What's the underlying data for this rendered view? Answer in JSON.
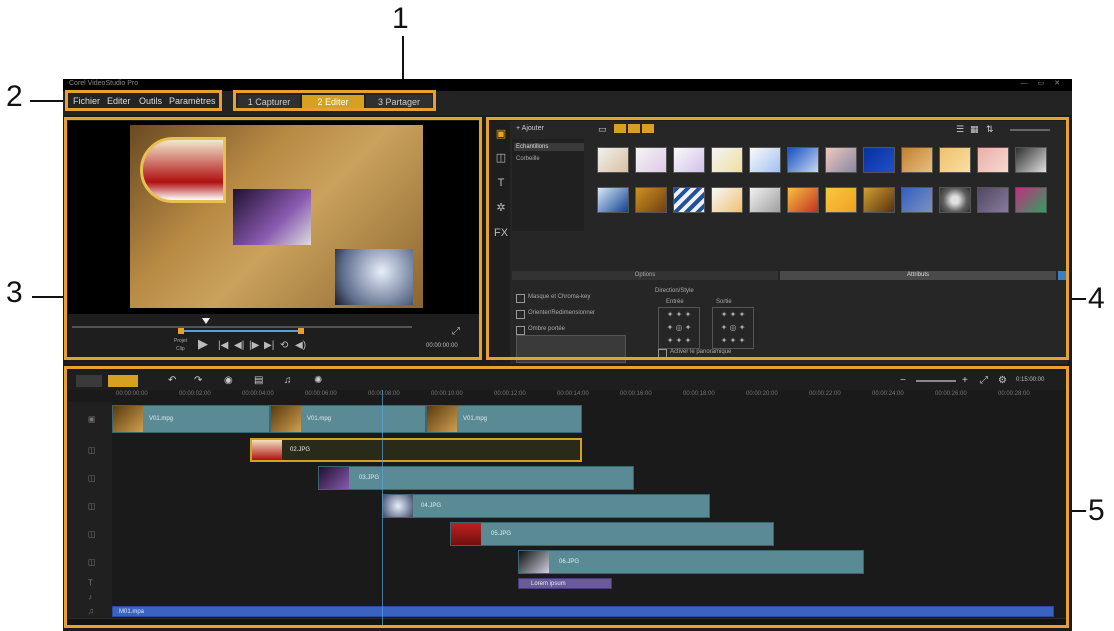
{
  "callouts": {
    "c1": "1",
    "c2": "2",
    "c3": "3",
    "c4": "4",
    "c5": "5"
  },
  "colors": {
    "callout_box": "#e8a030",
    "accent_tab": "#d6a020",
    "clip": "#5a8a94",
    "audio_track": "#3a62c0",
    "title_clip": "#6a5a9a"
  },
  "titlebar": {
    "title": "Corel VideoStudio Pro",
    "window_controls": "— ▭ ✕"
  },
  "menu": {
    "items": [
      "Fichier",
      "Editer",
      "Outils",
      "Paramètres"
    ]
  },
  "steps": {
    "tabs": [
      "1 Capturer",
      "2 Editer",
      "3 Partager"
    ],
    "active": "2 Editer"
  },
  "player": {
    "mode_labels": [
      "Projet",
      "Clip"
    ],
    "timecode": "00:00:00:00",
    "control_icons": [
      "play-icon",
      "home-icon",
      "previous-frame-icon",
      "next-frame-icon",
      "end-icon",
      "repeat-icon",
      "volume-icon"
    ]
  },
  "library": {
    "add_label": "Ajouter",
    "folders": [
      "Echantillons",
      "Corbeille"
    ],
    "tabs": [
      "Options",
      "Attributs"
    ],
    "opt_1": "Masque et Chroma-key",
    "opt_2": "Orienter/Redimensionner",
    "opt_3": "Ombre portée",
    "direction_style_label": "Direction/Style",
    "entry_label": "Entrée",
    "exit_label": "Sortie",
    "apply_effect_label": "Activer le panoramique"
  },
  "timeline": {
    "ruler_ticks": [
      "00:00:00:00",
      "00:00:02:00",
      "00:00:04:00",
      "00:00:06:00",
      "00:00:08:00",
      "00:00:10:00",
      "00:00:12:00",
      "00:00:14:00",
      "00:00:16:00",
      "00:00:18:00",
      "00:00:20:00",
      "00:00:22:00",
      "00:00:24:00",
      "00:00:26:00",
      "00:00:28:00"
    ],
    "zoom_label": "0:15:00:00",
    "clips": {
      "video_1": "V01.mpg",
      "video_2": "V01.mpg",
      "video_3": "V01.mpg",
      "overlay_1": "02.JPG",
      "overlay_2": "03.JPG",
      "overlay_3": "04.JPG",
      "overlay_4": "05.JPG",
      "overlay_5": "06.JPG",
      "title": "Lorem ipsum",
      "audio": "M01.mpa"
    }
  }
}
